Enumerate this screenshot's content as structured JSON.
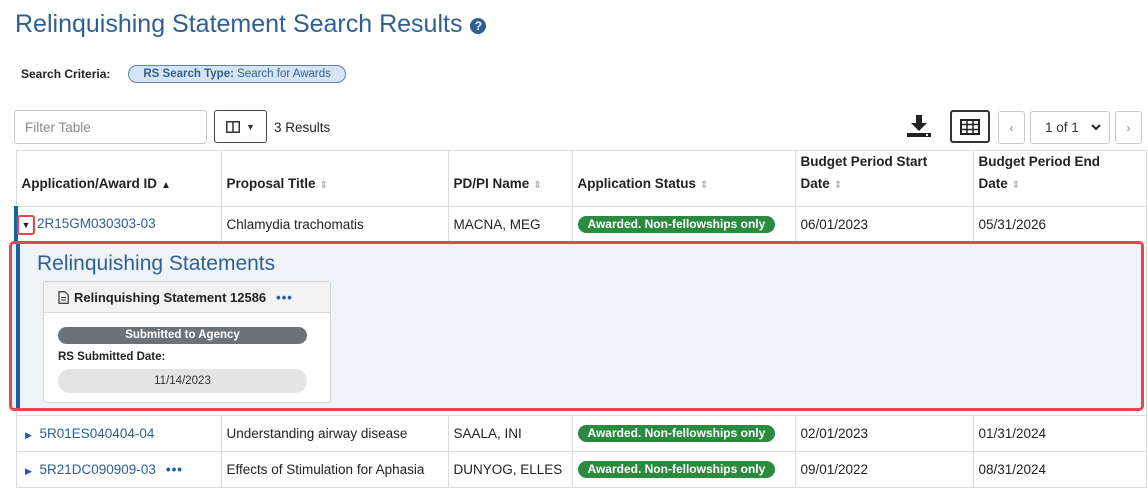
{
  "page": {
    "title": "Relinquishing Statement Search Results"
  },
  "criteria": {
    "label": "Search Criteria:",
    "pill_key": "RS Search Type:",
    "pill_value": "Search for Awards"
  },
  "toolbar": {
    "filter_placeholder": "Filter Table",
    "results_count": "3 Results",
    "pager_value": "1 of 1"
  },
  "table": {
    "headers": [
      "Application/Award ID",
      "Proposal Title",
      "PD/PI Name",
      "Application Status",
      "Budget Period Start Date",
      "Budget Period End Date"
    ],
    "rows": [
      {
        "id": "2R15GM030303-03",
        "title": "Chlamydia trachomatis",
        "pi": "MACNA, MEG",
        "status": "Awarded. Non-fellowships only",
        "start": "06/01/2023",
        "end": "05/31/2026"
      },
      {
        "id": "5R01ES040404-04",
        "title": "Understanding airway disease",
        "pi": "SAALA, INI",
        "status": "Awarded. Non-fellowships only",
        "start": "02/01/2023",
        "end": "01/31/2024"
      },
      {
        "id": "5R21DC090909-03",
        "title": "Effects of Stimulation for Aphasia",
        "pi": "DUNYOG, ELLES",
        "status": "Awarded. Non-fellowships only",
        "start": "09/01/2022",
        "end": "08/31/2024"
      }
    ]
  },
  "detail": {
    "title": "Relinquishing Statements",
    "card_title": "Relinquishing Statement 12586",
    "status": "Submitted to Agency",
    "date_label": "RS Submitted Date:",
    "date_value": "11/14/2023"
  },
  "colors": {
    "primary": "#2f5f93",
    "accent_bar": "#1d5fa6",
    "highlight": "#e8464f",
    "badge_green": "#2b8a3e",
    "badge_gray": "#6c7378"
  },
  "icons": [
    "help-icon",
    "columns-icon",
    "caret-down-icon",
    "download-icon",
    "grid-view-icon",
    "chevron-left-icon",
    "chevron-right-icon",
    "chevron-down-icon",
    "sort-asc-icon",
    "sort-icon",
    "caret-right-icon",
    "document-icon",
    "more-icon"
  ]
}
